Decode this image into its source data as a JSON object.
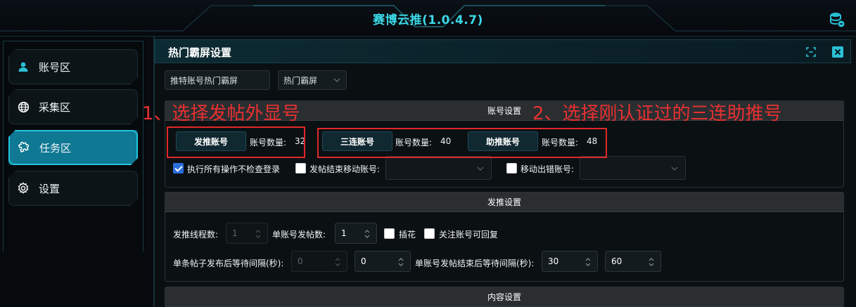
{
  "app": {
    "title": "赛博云推(1.0.4.7)"
  },
  "sidebar": {
    "items": [
      {
        "label": "账号区",
        "icon": "user-icon",
        "active": false
      },
      {
        "label": "采集区",
        "icon": "globe-icon",
        "active": false
      },
      {
        "label": "任务区",
        "icon": "puzzle-icon",
        "active": true
      },
      {
        "label": "设置",
        "icon": "gear-icon",
        "active": false
      }
    ]
  },
  "panel": {
    "title": "热门霸屏设置",
    "task_name": "推特账号热门霸屏",
    "task_type": "热门霸屏"
  },
  "account_settings": {
    "header": "账号设置",
    "post_account_button": "发推账号",
    "post_account_count_label": "账号数量:",
    "post_account_count": "32",
    "triple_account_button": "三连账号",
    "triple_account_count_label": "账号数量:",
    "triple_account_count": "40",
    "help_account_button": "助推账号",
    "help_account_count_label": "账号数量:",
    "help_account_count": "48",
    "skip_login_check_label": "执行所有操作不检查登录",
    "skip_login_check": true,
    "move_after_post_label": "发帖结束移动账号:",
    "move_after_post": false,
    "move_error_label": "移动出错账号:",
    "move_error": false
  },
  "post_settings": {
    "header": "发推设置",
    "threads_label": "发推线程数:",
    "threads_value": "1",
    "posts_per_account_label": "单账号发帖数:",
    "posts_per_account_value": "1",
    "flower_label": "插花",
    "flower": false,
    "reply_follow_label": "关注账号可回复",
    "reply_follow": false,
    "post_wait_label": "单条帖子发布后等待间隔(秒):",
    "post_wait_min": "0",
    "post_wait_max": "0",
    "account_wait_label": "单账号发帖结束后等待间隔(秒):",
    "account_wait_min": "30",
    "account_wait_max": "60"
  },
  "content_settings": {
    "header": "内容设置"
  },
  "annotations": {
    "note1": "1、选择发帖外显号",
    "note2": "2、选择刚认证过的三连助推号"
  },
  "colors": {
    "accent": "#22c6de",
    "annotation": "#e83030",
    "active_bg": "#0f7893"
  }
}
